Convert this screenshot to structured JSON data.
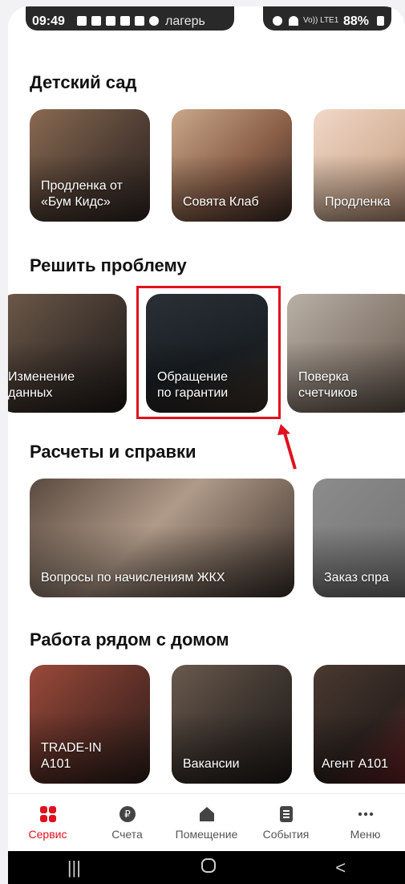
{
  "status_bar": {
    "time": "09:49",
    "partial_text": "лагерь",
    "battery": "88%",
    "network": "Vo)) LTE1"
  },
  "sections": [
    {
      "title": "Детский сад",
      "cards": [
        {
          "label": "Продленка от\n«Бум Кидс»"
        },
        {
          "label": "Совята Клаб"
        },
        {
          "label": "Продленка"
        }
      ]
    },
    {
      "title": "Решить проблему",
      "cards": [
        {
          "label": "Изменение\nданных"
        },
        {
          "label": "Обращение\nпо гарантии"
        },
        {
          "label": "Поверка\nсчетчиков"
        }
      ]
    },
    {
      "title": "Расчеты и справки",
      "cards": [
        {
          "label": "Вопросы по начислениям ЖКХ"
        },
        {
          "label": "Заказ спра"
        }
      ]
    },
    {
      "title": "Работа рядом с домом",
      "cards": [
        {
          "label": "TRADE-IN\nA101"
        },
        {
          "label": "Вакансии"
        },
        {
          "label": "Агент А101"
        }
      ]
    }
  ],
  "tabs": [
    {
      "label": "Сервис",
      "icon": "apps-icon",
      "active": true
    },
    {
      "label": "Счета",
      "icon": "ruble-icon",
      "active": false
    },
    {
      "label": "Помещение",
      "icon": "home-icon",
      "active": false
    },
    {
      "label": "События",
      "icon": "list-icon",
      "active": false
    },
    {
      "label": "Меню",
      "icon": "more-icon",
      "active": false
    }
  ],
  "colors": {
    "accent": "#e0101e",
    "highlight_box": "#e0101e"
  }
}
